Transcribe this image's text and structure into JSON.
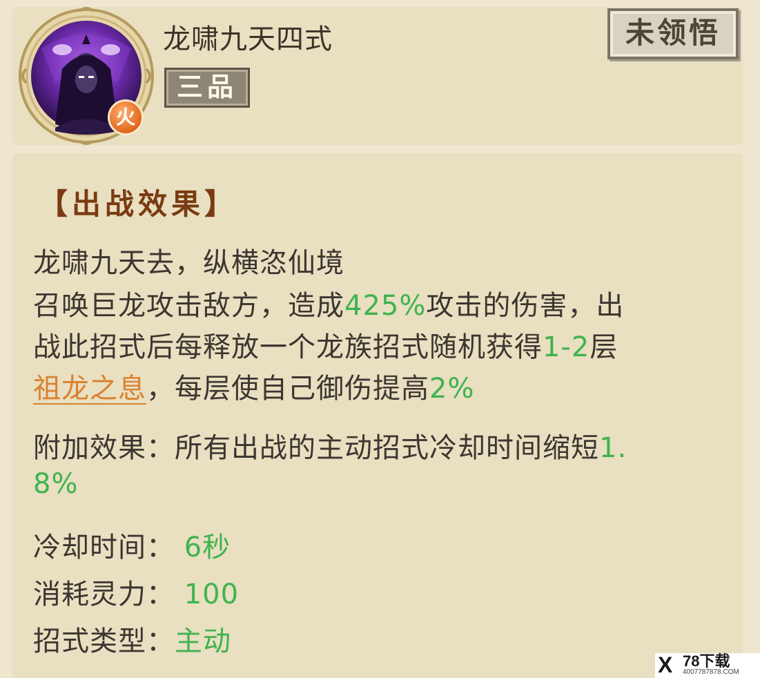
{
  "skill": {
    "name": "龙啸九天四式",
    "grade": "三品",
    "status": "未领悟",
    "element": "火",
    "icon": "dragon-sage-portrait"
  },
  "effect": {
    "section_title": "【出战效果】",
    "flavor": "龙啸九天去，纵横恣仙境",
    "desc_1a": "召唤巨龙攻击敌方，造成",
    "desc_1_val": "425%",
    "desc_1b": "攻击的伤害，出",
    "desc_2a": "战此招式后每释放一个龙族招式随机获得",
    "desc_2_val": "1-2",
    "desc_2b": "层",
    "desc_3_link": "祖龙之息",
    "desc_3a": "，每层使自己御伤提高",
    "desc_3_val": "2%"
  },
  "bonus": {
    "label": "附加效果：所有出战的主动招式冷却时间缩短",
    "val_a": "1.",
    "val_b": "8%"
  },
  "stats": {
    "cooldown_label": "冷却时间：",
    "cooldown_value": "6秒",
    "cost_label": "消耗灵力：",
    "cost_value": "100",
    "type_label": "招式类型：",
    "type_value": "主动"
  },
  "watermark": {
    "mark": "X",
    "brand": "78下载",
    "url": "4007787878.COM"
  },
  "colors": {
    "value_green": "#3fb34f",
    "link_orange": "#d9822f",
    "section_brown": "#7a3b12",
    "panel_bg": "#e9dfc1"
  }
}
